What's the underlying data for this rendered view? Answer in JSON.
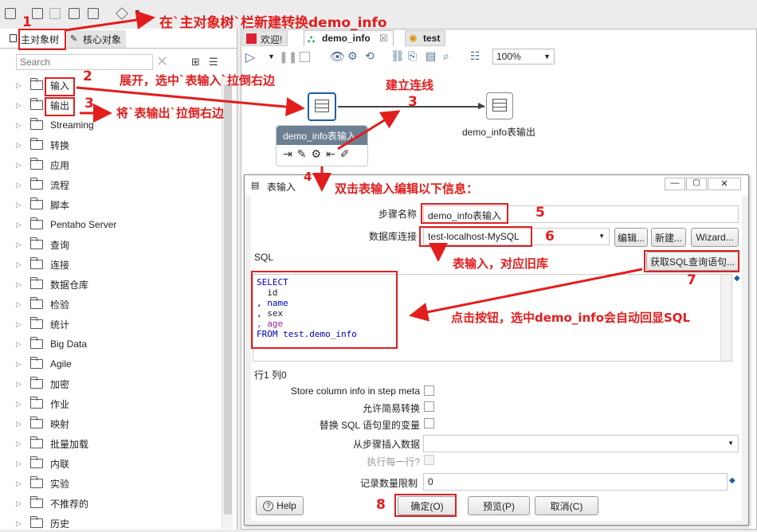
{
  "toolbar": {
    "perspective_menu": "▾"
  },
  "left": {
    "tabs": [
      "主对象树",
      "核心对象"
    ],
    "search_placeholder": "Search",
    "tree_items": [
      "输入",
      "输出",
      "Streaming",
      "转换",
      "应用",
      "流程",
      "脚本",
      "Pentaho Server",
      "查询",
      "连接",
      "数据仓库",
      "检验",
      "统计",
      "Big Data",
      "Agile",
      "加密",
      "作业",
      "映射",
      "批量加载",
      "内联",
      "实验",
      "不推荐的",
      "历史"
    ]
  },
  "tabs": {
    "welcome": "欢迎!",
    "demo": "demo_info",
    "test": "test"
  },
  "canvas_toolbar": {
    "zoom": "100%"
  },
  "canvas": {
    "step_input": "demo_info表输入",
    "step_output": "demo_info表输出"
  },
  "dialog": {
    "title": "表输入",
    "step_name_label": "步骤名称",
    "step_name_value": "demo_info表输入",
    "db_label": "数据库连接",
    "db_value": "test-localhost-MySQL",
    "edit_btn": "编辑...",
    "new_btn": "新建...",
    "wizard_btn": "Wizard...",
    "sql_label": "SQL",
    "get_sql_btn": "获取SQL查询语句...",
    "sql_lines": [
      "SELECT",
      "  id",
      ", name",
      ", sex",
      ", age",
      "FROM test.demo_info"
    ],
    "cursor_pos": "行1 列0",
    "store_col_label": "Store column info in step meta",
    "lazy_label": "允许简易转换",
    "replace_var_label": "替换 SQL 语句里的变量",
    "insert_from_label": "从步骤插入数据",
    "exec_each_label": "执行每一行?",
    "limit_label": "记录数量限制",
    "limit_value": "0",
    "help_btn": "Help",
    "ok_btn": "确定(O)",
    "preview_btn": "预览(P)",
    "cancel_btn": "取消(C)"
  },
  "annotations": {
    "n1": "1",
    "a1": "在`主对象树`栏新建转换demo_info",
    "n2": "2",
    "a2": "展开，选中`表输入`拉倒右边",
    "n3a": "3",
    "a3": "将`表输出`拉倒右边",
    "a3b": "建立连线",
    "n3b": "3",
    "n4": "4",
    "a4": "双击表输入编辑以下信息：",
    "n5": "5",
    "n6": "6",
    "a6": "表输入，对应旧库",
    "n7": "7",
    "a7": "点击按钮，选中demo_info会自动回显SQL",
    "n8": "8"
  },
  "colors": {
    "annotation": "#e21d1d",
    "sql_keyword": "#0000c0",
    "sql_field_name": "#0000c0",
    "sql_field_age": "#a020a0"
  }
}
